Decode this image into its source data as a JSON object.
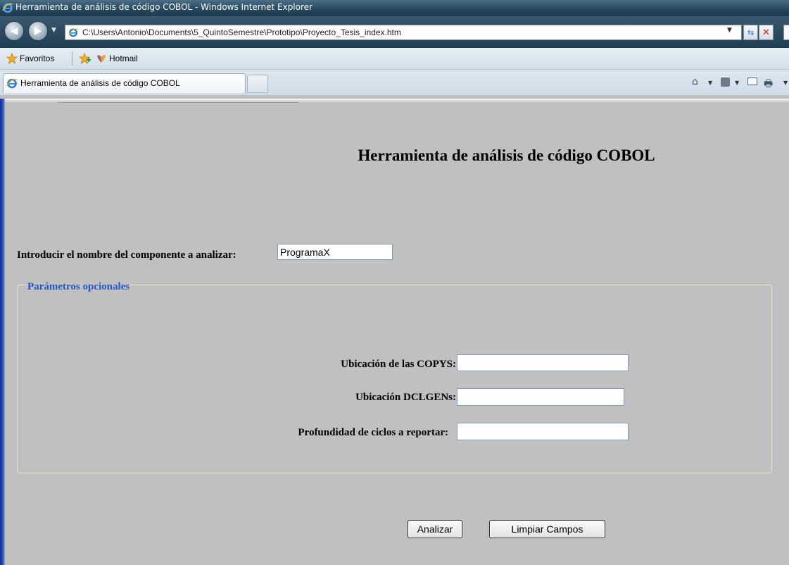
{
  "window": {
    "title": "Herramienta de análisis de código COBOL - Windows Internet Explorer"
  },
  "browser": {
    "address": "C:\\Users\\Antonio\\Documents\\5_QuintoSemestre\\Prototipo\\Proyecto_Tesis_index.htm",
    "favorites_label": "Favoritos",
    "favorite_links": [
      "Hotmail"
    ],
    "tabs": [
      {
        "label": "Herramienta de análisis de código COBOL",
        "active": true
      }
    ],
    "icons": [
      "ie-icon",
      "back-arrow-icon",
      "forward-arrow-icon",
      "refresh-icon",
      "stop-icon",
      "favorites-star-icon",
      "add-favorite-icon",
      "hotmail-icon",
      "home-icon",
      "feeds-icon",
      "mail-icon",
      "print-icon"
    ]
  },
  "page": {
    "title": "Herramienta de análisis de código COBOL",
    "component_label": "Introducir el nombre del componente a analizar:",
    "component_value": "ProgramaX",
    "optional_legend": "Parámetros opcionales",
    "copys_label": "Ubicación de las COPYS:",
    "copys_value": "",
    "dclgen_label": "Ubicación DCLGENs:",
    "dclgen_value": "",
    "depth_label": "Profundidad de ciclos a reportar:",
    "depth_value": "",
    "analyze_button": "Analizar",
    "clear_button": "Limpiar Campos"
  },
  "colors": {
    "page_background": "#c0c0c0",
    "legend_text": "#2456c8"
  }
}
